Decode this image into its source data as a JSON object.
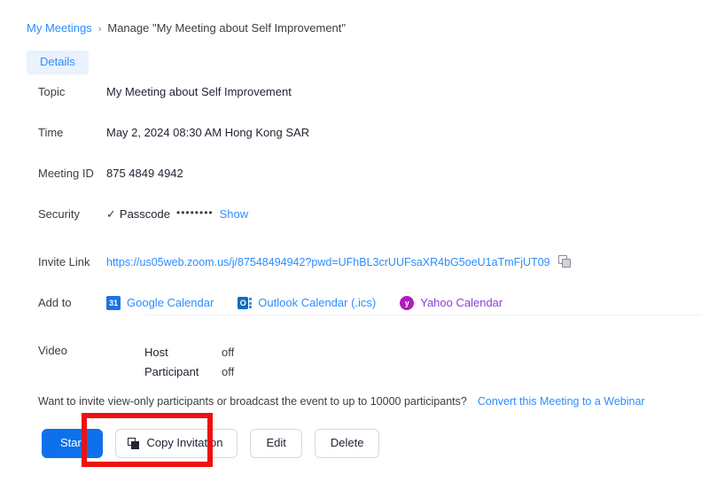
{
  "breadcrumb": {
    "root": "My Meetings",
    "separator": "›",
    "current": "Manage \"My Meeting about Self Improvement\""
  },
  "tabs": [
    {
      "label": "Details",
      "active": true
    }
  ],
  "details": {
    "topic": {
      "label": "Topic",
      "value": "My Meeting about Self Improvement"
    },
    "time": {
      "label": "Time",
      "value": "May 2, 2024 08:30 AM Hong Kong SAR"
    },
    "meeting_id": {
      "label": "Meeting ID",
      "value": "875 4849 4942"
    },
    "security": {
      "label": "Security",
      "check_glyph": "✓",
      "passcode_label": "Passcode",
      "passcode_mask": "••••••••",
      "show_label": "Show"
    },
    "invite_link": {
      "label": "Invite Link",
      "url": "https://us05web.zoom.us/j/87548494942?pwd=UFhBL3crUUFsaXR4bG5oeU1aTmFjUT09",
      "copy_icon": "copy-icon"
    },
    "add_to": {
      "label": "Add to",
      "calendars": [
        {
          "name": "Google Calendar",
          "icon": "google-calendar-icon",
          "icon_text": "31",
          "color": "#2d8cff"
        },
        {
          "name": "Outlook Calendar (.ics)",
          "icon": "outlook-calendar-icon",
          "icon_text": "O",
          "color": "#2d8cff"
        },
        {
          "name": "Yahoo Calendar",
          "icon": "yahoo-calendar-icon",
          "icon_text": "y",
          "color": "#8b3fd9"
        }
      ]
    },
    "video": {
      "label": "Video",
      "rows": [
        {
          "key": "Host",
          "value": "off"
        },
        {
          "key": "Participant",
          "value": "off"
        }
      ]
    }
  },
  "webinar_notice": {
    "text": "Want to invite view-only participants or broadcast the event to up to 10000 participants?",
    "link": "Convert this Meeting to a Webinar"
  },
  "buttons": {
    "start": "Start",
    "copy_invitation": "Copy Invitation",
    "edit": "Edit",
    "delete": "Delete"
  },
  "annotation": {
    "color": "#ee1111",
    "target": "copy-invitation-button"
  }
}
